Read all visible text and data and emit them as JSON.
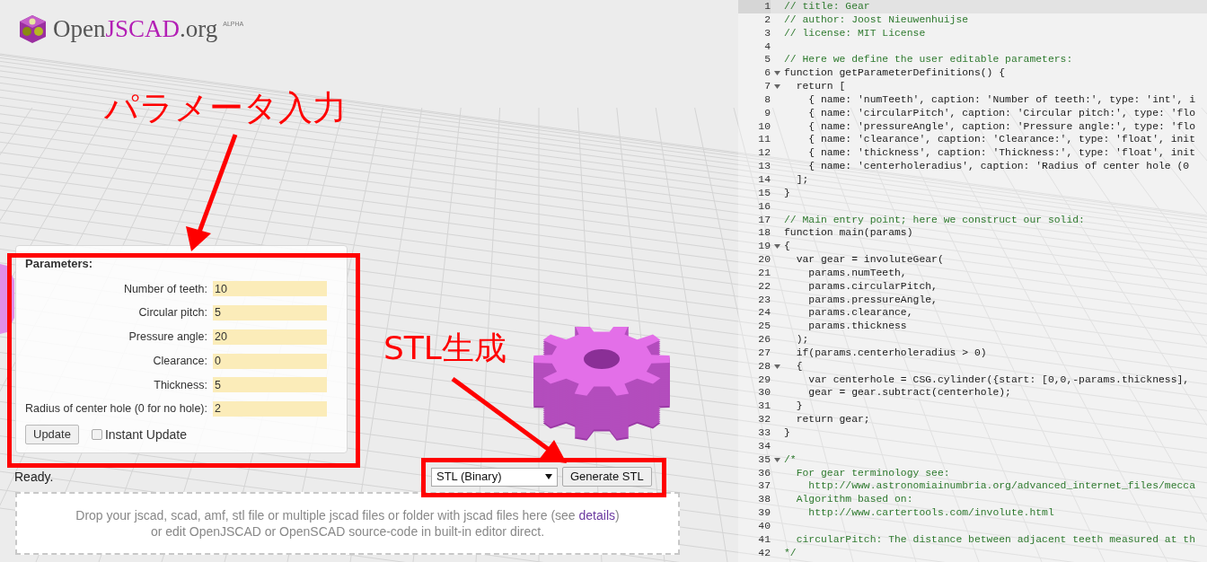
{
  "logo": {
    "parts": [
      {
        "text": "Open",
        "accent": false
      },
      {
        "text": "JSCAD",
        "accent": true
      },
      {
        "text": ".org",
        "accent": false
      }
    ],
    "badge": "ALPHA"
  },
  "annotations": [
    {
      "text": "パラメータ入力"
    },
    {
      "text": "STL生成"
    }
  ],
  "parameters": {
    "title": "Parameters:",
    "fields": [
      {
        "label": "Number of teeth:",
        "value": "10"
      },
      {
        "label": "Circular pitch:",
        "value": "5"
      },
      {
        "label": "Pressure angle:",
        "value": "20"
      },
      {
        "label": "Clearance:",
        "value": "0"
      },
      {
        "label": "Thickness:",
        "value": "5"
      },
      {
        "label": "Radius of center hole (0 for no hole):",
        "value": "2"
      }
    ],
    "update_button": "Update",
    "instant_update": {
      "label": "Instant Update",
      "checked": false
    }
  },
  "status": "Ready.",
  "export": {
    "format": "STL (Binary)",
    "button": "Generate STL"
  },
  "drop_zone": {
    "text_1": "Drop your jscad, scad, amf, stl file or multiple jscad files or folder with jscad files here (see ",
    "link": "details",
    "text_2": ")",
    "text_3": "or edit OpenJSCAD or OpenSCAD source-code in built-in editor direct."
  },
  "editor": {
    "lines": [
      {
        "number": "1",
        "text": "// title: Gear",
        "kind": "comment",
        "fold": false,
        "active": true
      },
      {
        "number": "2",
        "text": "// author: Joost Nieuwenhuijse",
        "kind": "comment",
        "fold": false,
        "active": false
      },
      {
        "number": "3",
        "text": "// license: MIT License",
        "kind": "comment",
        "fold": false,
        "active": false
      },
      {
        "number": "4",
        "kind": "blank",
        "fold": false,
        "active": false
      },
      {
        "number": "5",
        "text": "// Here we define the user editable parameters:",
        "kind": "comment",
        "fold": false,
        "active": false
      },
      {
        "number": "6",
        "text": "function getParameterDefinitions() {",
        "kind": "code",
        "fold": true,
        "active": false
      },
      {
        "number": "7",
        "text": "  return [",
        "kind": "code",
        "fold": true,
        "active": false
      },
      {
        "number": "8",
        "text": "    { name: 'numTeeth', caption: 'Number of teeth:', type: 'int', i",
        "kind": "code",
        "fold": false,
        "active": false
      },
      {
        "number": "9",
        "text": "    { name: 'circularPitch', caption: 'Circular pitch:', type: 'flo",
        "kind": "code",
        "fold": false,
        "active": false
      },
      {
        "number": "10",
        "text": "    { name: 'pressureAngle', caption: 'Pressure angle:', type: 'flo",
        "kind": "code",
        "fold": false,
        "active": false
      },
      {
        "number": "11",
        "text": "    { name: 'clearance', caption: 'Clearance:', type: 'float', init",
        "kind": "code",
        "fold": false,
        "active": false
      },
      {
        "number": "12",
        "text": "    { name: 'thickness', caption: 'Thickness:', type: 'float', init",
        "kind": "code",
        "fold": false,
        "active": false
      },
      {
        "number": "13",
        "text": "    { name: 'centerholeradius', caption: 'Radius of center hole (0",
        "kind": "code",
        "fold": false,
        "active": false
      },
      {
        "number": "14",
        "text": "  ];",
        "kind": "code",
        "fold": false,
        "active": false
      },
      {
        "number": "15",
        "text": "}",
        "kind": "code",
        "fold": false,
        "active": false
      },
      {
        "number": "16",
        "kind": "blank",
        "fold": false,
        "active": false
      },
      {
        "number": "17",
        "text": "// Main entry point; here we construct our solid:",
        "kind": "comment",
        "fold": false,
        "active": false
      },
      {
        "number": "18",
        "text": "function main(params)",
        "kind": "code",
        "fold": false,
        "active": false
      },
      {
        "number": "19",
        "text": "{",
        "kind": "code",
        "fold": true,
        "active": false
      },
      {
        "number": "20",
        "text": "  var gear = involuteGear(",
        "kind": "code",
        "fold": false,
        "active": false
      },
      {
        "number": "21",
        "text": "    params.numTeeth,",
        "kind": "code",
        "fold": false,
        "active": false
      },
      {
        "number": "22",
        "text": "    params.circularPitch,",
        "kind": "code",
        "fold": false,
        "active": false
      },
      {
        "number": "23",
        "text": "    params.pressureAngle,",
        "kind": "code",
        "fold": false,
        "active": false
      },
      {
        "number": "24",
        "text": "    params.clearance,",
        "kind": "code",
        "fold": false,
        "active": false
      },
      {
        "number": "25",
        "text": "    params.thickness",
        "kind": "code",
        "fold": false,
        "active": false
      },
      {
        "number": "26",
        "text": "  );",
        "kind": "code",
        "fold": false,
        "active": false
      },
      {
        "number": "27",
        "text": "  if(params.centerholeradius > 0)",
        "kind": "code",
        "fold": false,
        "active": false
      },
      {
        "number": "28",
        "text": "  {",
        "kind": "code",
        "fold": true,
        "active": false
      },
      {
        "number": "29",
        "text": "    var centerhole = CSG.cylinder({start: [0,0,-params.thickness],",
        "kind": "code",
        "fold": false,
        "active": false
      },
      {
        "number": "30",
        "text": "    gear = gear.subtract(centerhole);",
        "kind": "code",
        "fold": false,
        "active": false
      },
      {
        "number": "31",
        "text": "  }",
        "kind": "code",
        "fold": false,
        "active": false
      },
      {
        "number": "32",
        "text": "  return gear;",
        "kind": "code",
        "fold": false,
        "active": false
      },
      {
        "number": "33",
        "text": "}",
        "kind": "code",
        "fold": false,
        "active": false
      },
      {
        "number": "34",
        "kind": "blank",
        "fold": false,
        "active": false
      },
      {
        "number": "35",
        "text": "/*",
        "kind": "comment",
        "fold": true,
        "active": false
      },
      {
        "number": "36",
        "text": "  For gear terminology see:",
        "kind": "comment",
        "fold": false,
        "active": false
      },
      {
        "number": "37",
        "text": "    http://www.astronomiainumbria.org/advanced_internet_files/mecca",
        "kind": "comment",
        "fold": false,
        "active": false
      },
      {
        "number": "38",
        "text": "  Algorithm based on:",
        "kind": "comment",
        "fold": false,
        "active": false
      },
      {
        "number": "39",
        "text": "    http://www.cartertools.com/involute.html",
        "kind": "comment",
        "fold": false,
        "active": false
      },
      {
        "number": "40",
        "kind": "blank",
        "fold": false,
        "active": false
      },
      {
        "number": "41",
        "text": "  circularPitch: The distance between adjacent teeth measured at th",
        "kind": "comment",
        "fold": false,
        "active": false
      },
      {
        "number": "42",
        "text": "*/",
        "kind": "comment",
        "fold": false,
        "active": false
      }
    ]
  }
}
